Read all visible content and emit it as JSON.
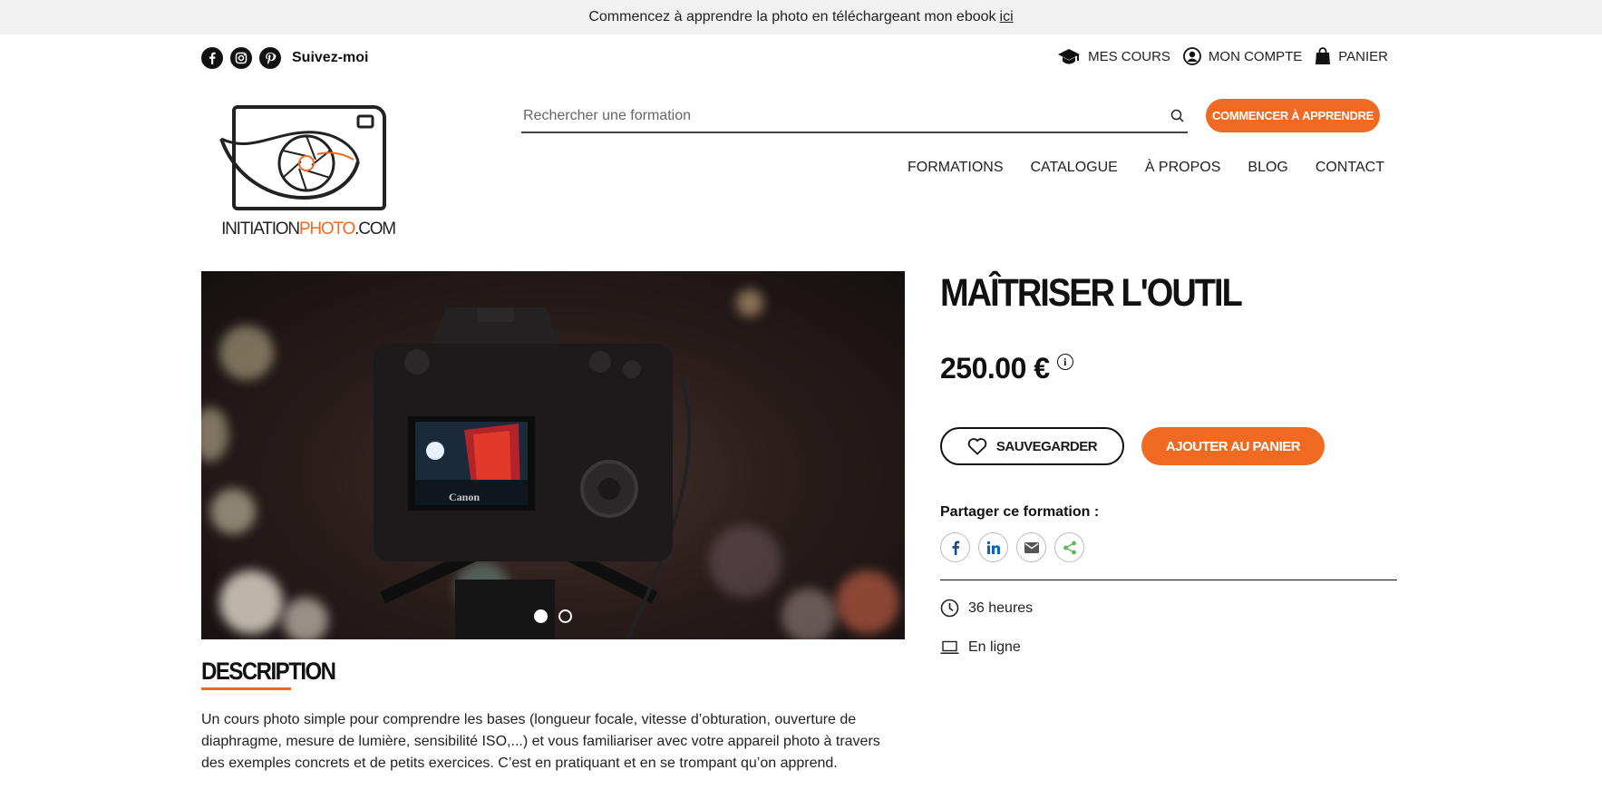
{
  "announcement": {
    "text": "Commencez à apprendre la photo en téléchargeant mon ebook",
    "link": "ici"
  },
  "social": {
    "label": "Suivez-moi",
    "icons": [
      "facebook-icon",
      "instagram-icon",
      "pinterest-icon"
    ]
  },
  "account_nav": {
    "courses": "MES COURS",
    "account": "MON COMPTE",
    "cart": "PANIER"
  },
  "logo": {
    "text_a": "INITIATION",
    "text_b": "PHOTO",
    "text_c": ".COM"
  },
  "search": {
    "placeholder": "Rechercher une formation"
  },
  "cta_top": "COMMENCER À APPRENDRE",
  "main_nav": [
    "FORMATIONS",
    "CATALOGUE",
    "À PROPOS",
    "BLOG",
    "CONTACT"
  ],
  "hero": {
    "camera_brand": "Canon",
    "slide_count": 2,
    "active_slide": 1
  },
  "product": {
    "title": "MAÎTRISER L'OUTIL",
    "price": "250.00 €",
    "info_icon": "i",
    "save_label": "SAUVEGARDER",
    "cart_label": "AJOUTER AU PANIER",
    "share_label": "Partager ce formation :",
    "share_icons": [
      "facebook-icon",
      "linkedin-icon",
      "email-icon",
      "share-icon"
    ],
    "duration": "36 heures",
    "mode": "En ligne"
  },
  "description": {
    "heading": "DESCRIPTION",
    "text": "Un cours photo simple pour comprendre les bases (longueur focale, vitesse d’obturation, ouverture de diaphragme, mesure de lumière, sensibilité ISO,...) et vous familiariser avec votre appareil photo à travers des exemples concrets et de petits exercices. C’est en pratiquant et en se trompant qu’on apprend."
  },
  "colors": {
    "accent": "#f26a21",
    "topbar": "#f1f1f1",
    "text": "#111111"
  }
}
